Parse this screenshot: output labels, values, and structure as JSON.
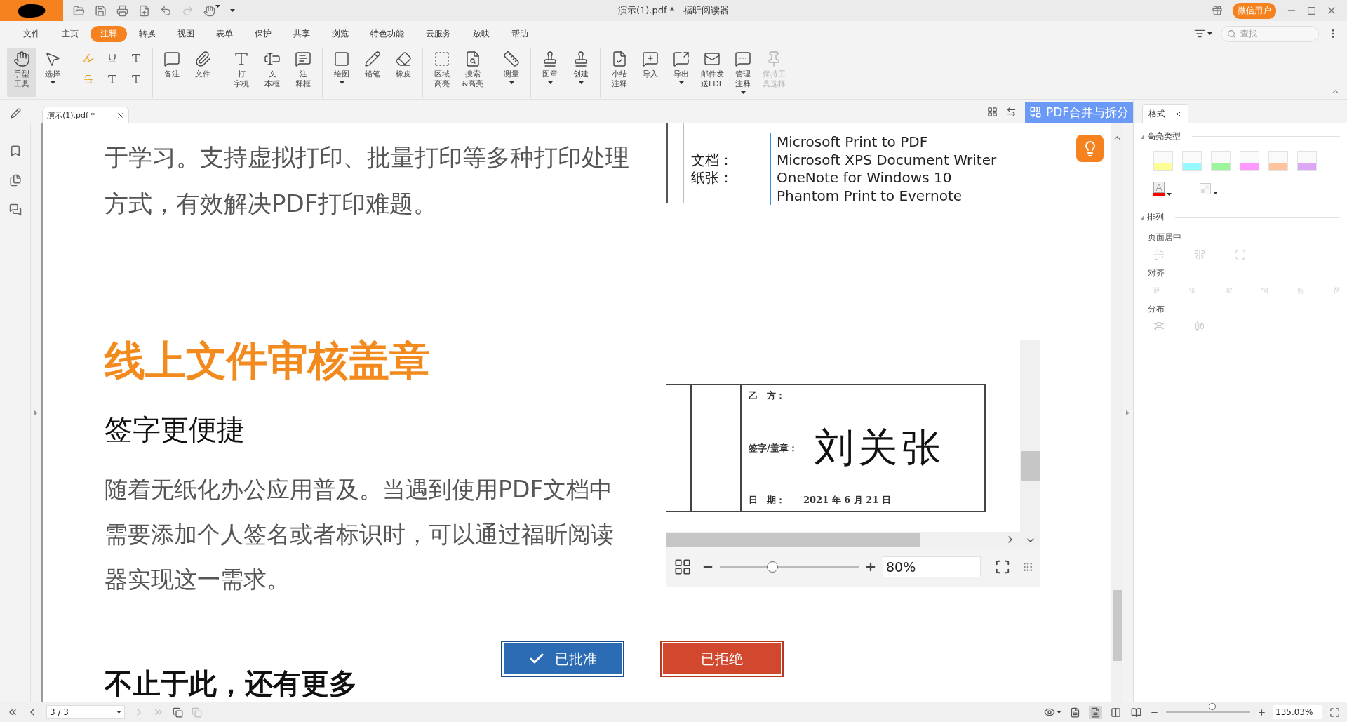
{
  "title_bar": {
    "title": "演示(1).pdf * - 福昕阅读器",
    "user": "微信用户"
  },
  "menu": [
    {
      "label": "文件",
      "selected": false
    },
    {
      "label": "主页",
      "selected": false
    },
    {
      "label": "注释",
      "selected": true
    },
    {
      "label": "转换",
      "selected": false
    },
    {
      "label": "视图",
      "selected": false
    },
    {
      "label": "表单",
      "selected": false
    },
    {
      "label": "保护",
      "selected": false
    },
    {
      "label": "共享",
      "selected": false
    },
    {
      "label": "浏览",
      "selected": false
    },
    {
      "label": "特色功能",
      "selected": false
    },
    {
      "label": "云服务",
      "selected": false
    },
    {
      "label": "放映",
      "selected": false
    },
    {
      "label": "帮助",
      "selected": false
    }
  ],
  "search": {
    "placeholder": "查找"
  },
  "ribbon": [
    {
      "kind": "large",
      "items": [
        {
          "lines": [
            "手型",
            "工具"
          ],
          "selected": true,
          "dropdown": false,
          "disabled": false
        },
        {
          "lines": [
            "选择"
          ],
          "selected": false,
          "dropdown": true,
          "disabled": false
        }
      ]
    },
    {
      "kind": "small"
    },
    {
      "kind": "large",
      "items": [
        {
          "lines": [
            "备注"
          ],
          "selected": false,
          "dropdown": false,
          "disabled": false
        },
        {
          "lines": [
            "文件"
          ],
          "selected": false,
          "dropdown": false,
          "disabled": false
        }
      ]
    },
    {
      "kind": "large",
      "items": [
        {
          "lines": [
            "打",
            "字机"
          ],
          "selected": false,
          "dropdown": false,
          "disabled": false
        },
        {
          "lines": [
            "文",
            "本框"
          ],
          "selected": false,
          "dropdown": false,
          "disabled": false
        },
        {
          "lines": [
            "注",
            "释框"
          ],
          "selected": false,
          "dropdown": false,
          "disabled": false
        }
      ]
    },
    {
      "kind": "large",
      "items": [
        {
          "lines": [
            "绘图"
          ],
          "selected": false,
          "dropdown": true,
          "disabled": false
        },
        {
          "lines": [
            "铅笔"
          ],
          "selected": false,
          "dropdown": false,
          "disabled": false
        },
        {
          "lines": [
            "橡皮"
          ],
          "selected": false,
          "dropdown": false,
          "disabled": false
        }
      ]
    },
    {
      "kind": "large",
      "items": [
        {
          "lines": [
            "区域",
            "高亮"
          ],
          "selected": false,
          "dropdown": false,
          "disabled": false
        },
        {
          "lines": [
            "搜索",
            "&高亮"
          ],
          "selected": false,
          "dropdown": false,
          "disabled": false
        }
      ]
    },
    {
      "kind": "large",
      "items": [
        {
          "lines": [
            "测量"
          ],
          "selected": false,
          "dropdown": true,
          "disabled": false
        }
      ]
    },
    {
      "kind": "large",
      "items": [
        {
          "lines": [
            "图章"
          ],
          "selected": false,
          "dropdown": true,
          "disabled": false
        },
        {
          "lines": [
            "创建"
          ],
          "selected": false,
          "dropdown": true,
          "disabled": false
        }
      ]
    },
    {
      "kind": "large",
      "items": [
        {
          "lines": [
            "小结",
            "注释"
          ],
          "selected": false,
          "dropdown": false,
          "disabled": false
        },
        {
          "lines": [
            "导入"
          ],
          "selected": false,
          "dropdown": false,
          "disabled": false
        },
        {
          "lines": [
            "导出"
          ],
          "selected": false,
          "dropdown": true,
          "disabled": false
        },
        {
          "lines": [
            "邮件发",
            "送FDF"
          ],
          "selected": false,
          "dropdown": false,
          "disabled": false
        },
        {
          "lines": [
            "管理",
            "注释"
          ],
          "selected": false,
          "dropdown": true,
          "disabled": false
        },
        {
          "lines": [
            "保持工",
            "具选择"
          ],
          "selected": false,
          "dropdown": false,
          "disabled": true
        }
      ]
    }
  ],
  "doc_tab": {
    "label": "演示(1).pdf *"
  },
  "merge_button": "PDF合并与拆分",
  "panel": {
    "tab": "格式",
    "highlight_title": "高亮类型",
    "highlight_types": [
      {
        "color": "#fdfd96"
      },
      {
        "color": "#96fbff"
      },
      {
        "color": "#9cf59c"
      },
      {
        "color": "#ff99ff"
      },
      {
        "color": "#ffc49e"
      },
      {
        "color": "#dca7f6"
      }
    ],
    "text_color_button": {
      "color": "#ff0000"
    },
    "arrange_title": "排列",
    "arrange_groups": [
      {
        "label": "页面居中"
      },
      {
        "label": "对齐"
      },
      {
        "label": "分布"
      }
    ]
  },
  "document": {
    "paragraph_1": "于学习。支持虚拟打印、批量打印等多种打印处理方式，有效解决PDF打印难题。",
    "printer_rows": [
      {
        "name": "Microsoft Print to PDF"
      },
      {
        "label": "文档：",
        "name": "Microsoft XPS Document Writer"
      },
      {
        "label": "纸张：",
        "name": "OneNote for Windows 10"
      },
      {
        "name": "Phantom Print to Evernote"
      }
    ],
    "heading": "线上文件审核盖章",
    "subheading": "签字更便捷",
    "paragraph_2": "随着无纸化办公应用普及。当遇到使用PDF文档中需要添加个人签名或者标识时，可以通过福昕阅读器实现这一需求。",
    "viewer": {
      "party": "乙　方：",
      "sign_label": "签字/盖章：",
      "signature": "刘关张",
      "date_label": "日　期：",
      "date": "2021 年 6 月 21 日",
      "zoom": "80%",
      "zoom_slider": {
        "level": 0.38
      }
    },
    "approve": "已批准",
    "reject": "已拒绝",
    "heading_2": "不止于此，还有更多"
  },
  "status_bar": {
    "page": "3 / 3",
    "zoom": "135.03%",
    "zoom_slider": {
      "level": 0.55
    },
    "view_modes": [
      {
        "selected": false
      },
      {
        "selected": true
      },
      {
        "selected": false
      },
      {
        "selected": false
      }
    ]
  }
}
